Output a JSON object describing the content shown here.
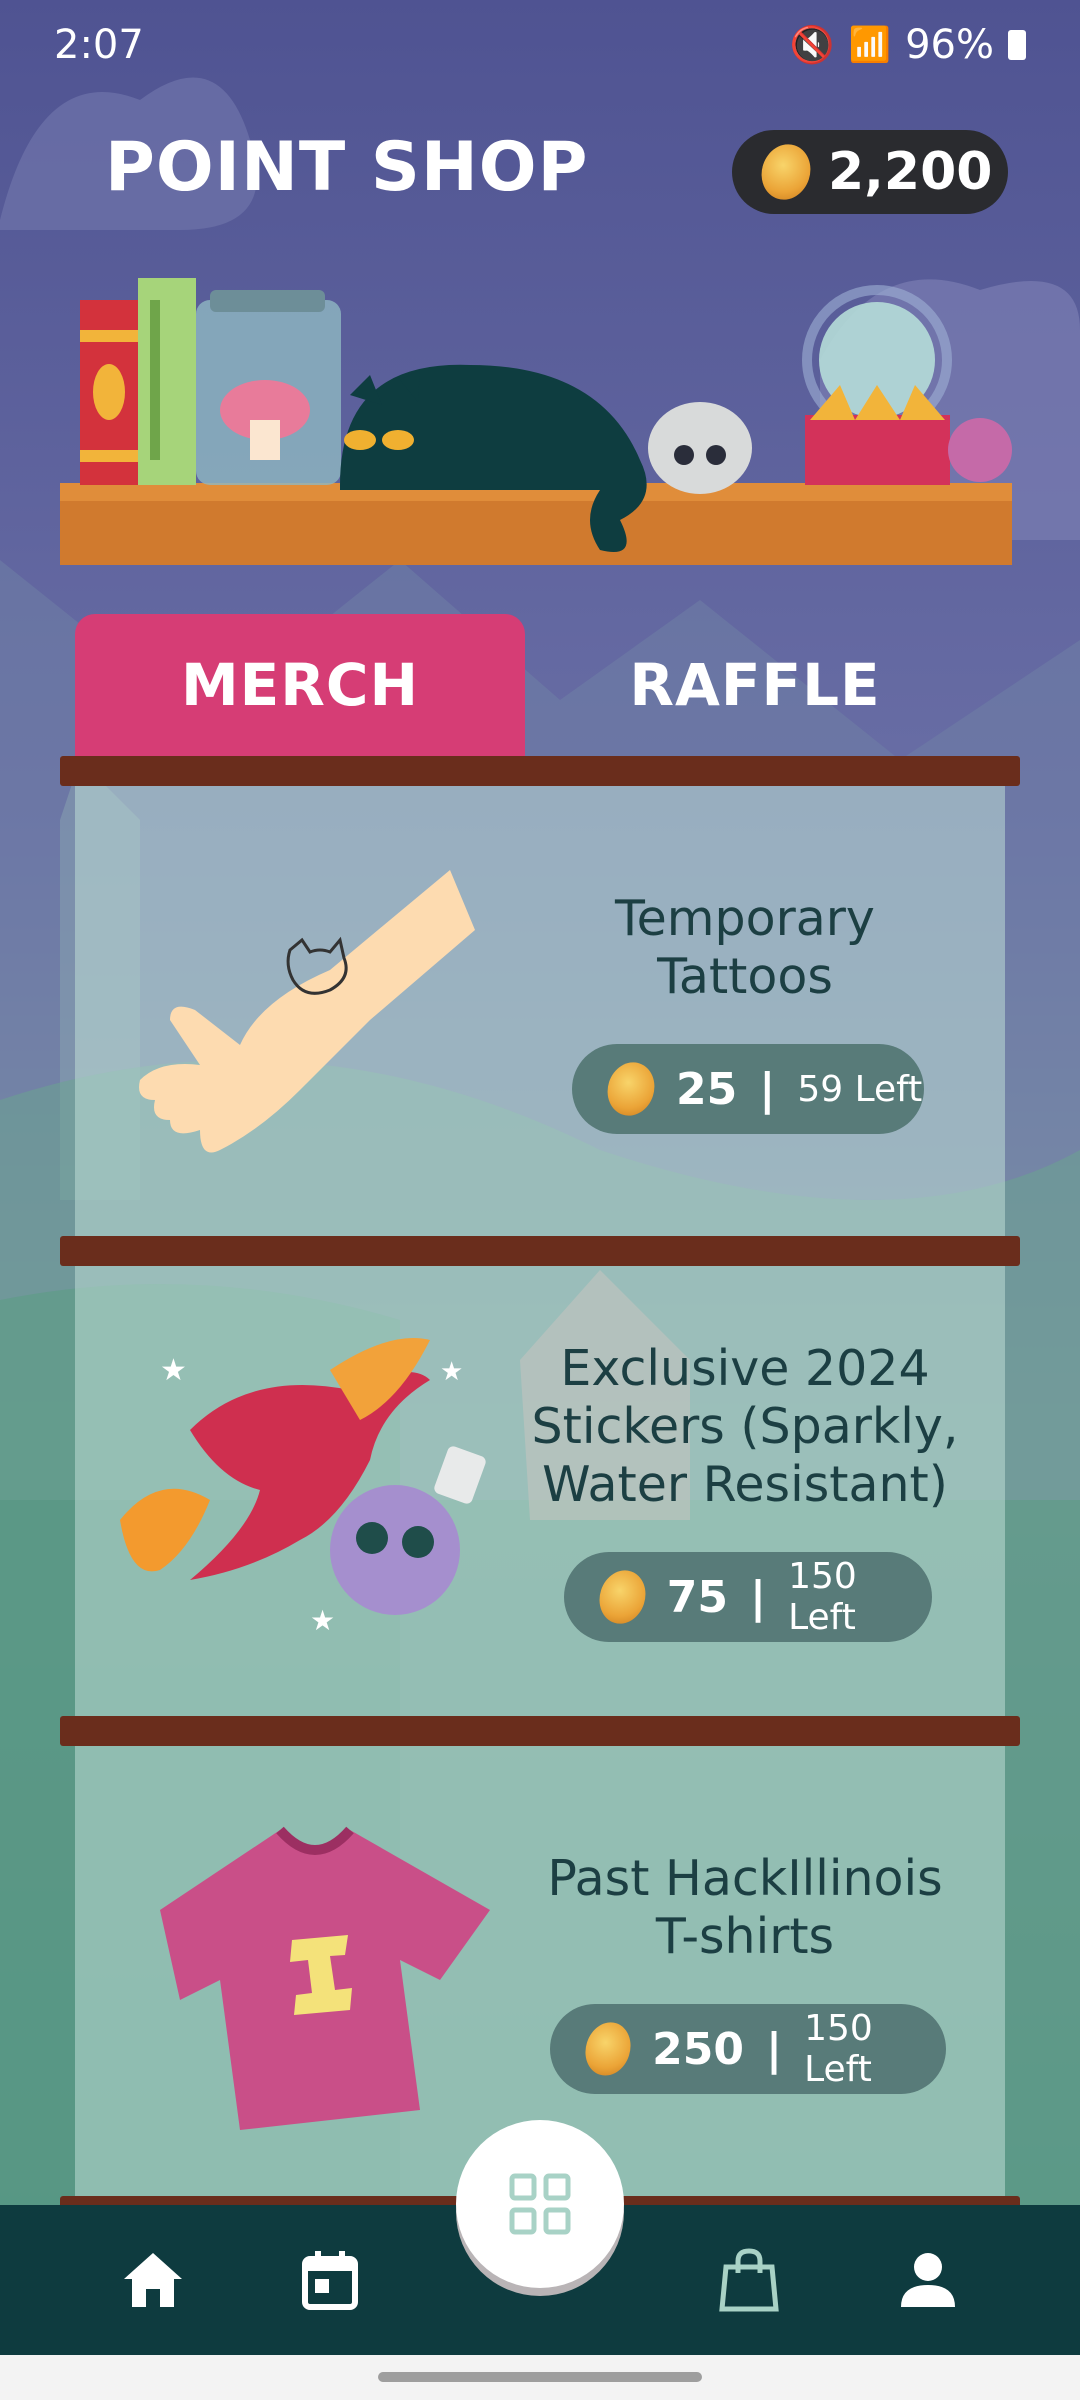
{
  "status_bar": {
    "time": "2:07",
    "battery": "96%"
  },
  "header": {
    "title": "POINT SHOP",
    "points": "2,200"
  },
  "tabs": [
    {
      "label": "MERCH",
      "active": true
    },
    {
      "label": "RAFFLE",
      "active": false
    }
  ],
  "items": [
    {
      "title_line1": "Temporary",
      "title_line2": "Tattoos",
      "title_line3": "",
      "points": "25",
      "separator": "|",
      "left": "59 Left"
    },
    {
      "title_line1": "Exclusive 2024",
      "title_line2": "Stickers (Sparkly,",
      "title_line3": "Water Resistant)",
      "points": "75",
      "separator": "|",
      "left": "150 Left"
    },
    {
      "title_line1": "Past HackIllinois",
      "title_line2": "T-shirts",
      "title_line3": "",
      "points": "250",
      "separator": "|",
      "left": "150 Left"
    }
  ],
  "bottom_nav": {
    "items": [
      "home-icon",
      "calendar-icon",
      "qr-code-icon",
      "shopping-bag-icon",
      "profile-icon"
    ],
    "active": "shopping-bag-icon"
  },
  "colors": {
    "accent_tab": "#d63d75",
    "nav_bg": "#0e3b3f",
    "price_pill": "#587b79",
    "shelf": "#6a2d1c"
  }
}
